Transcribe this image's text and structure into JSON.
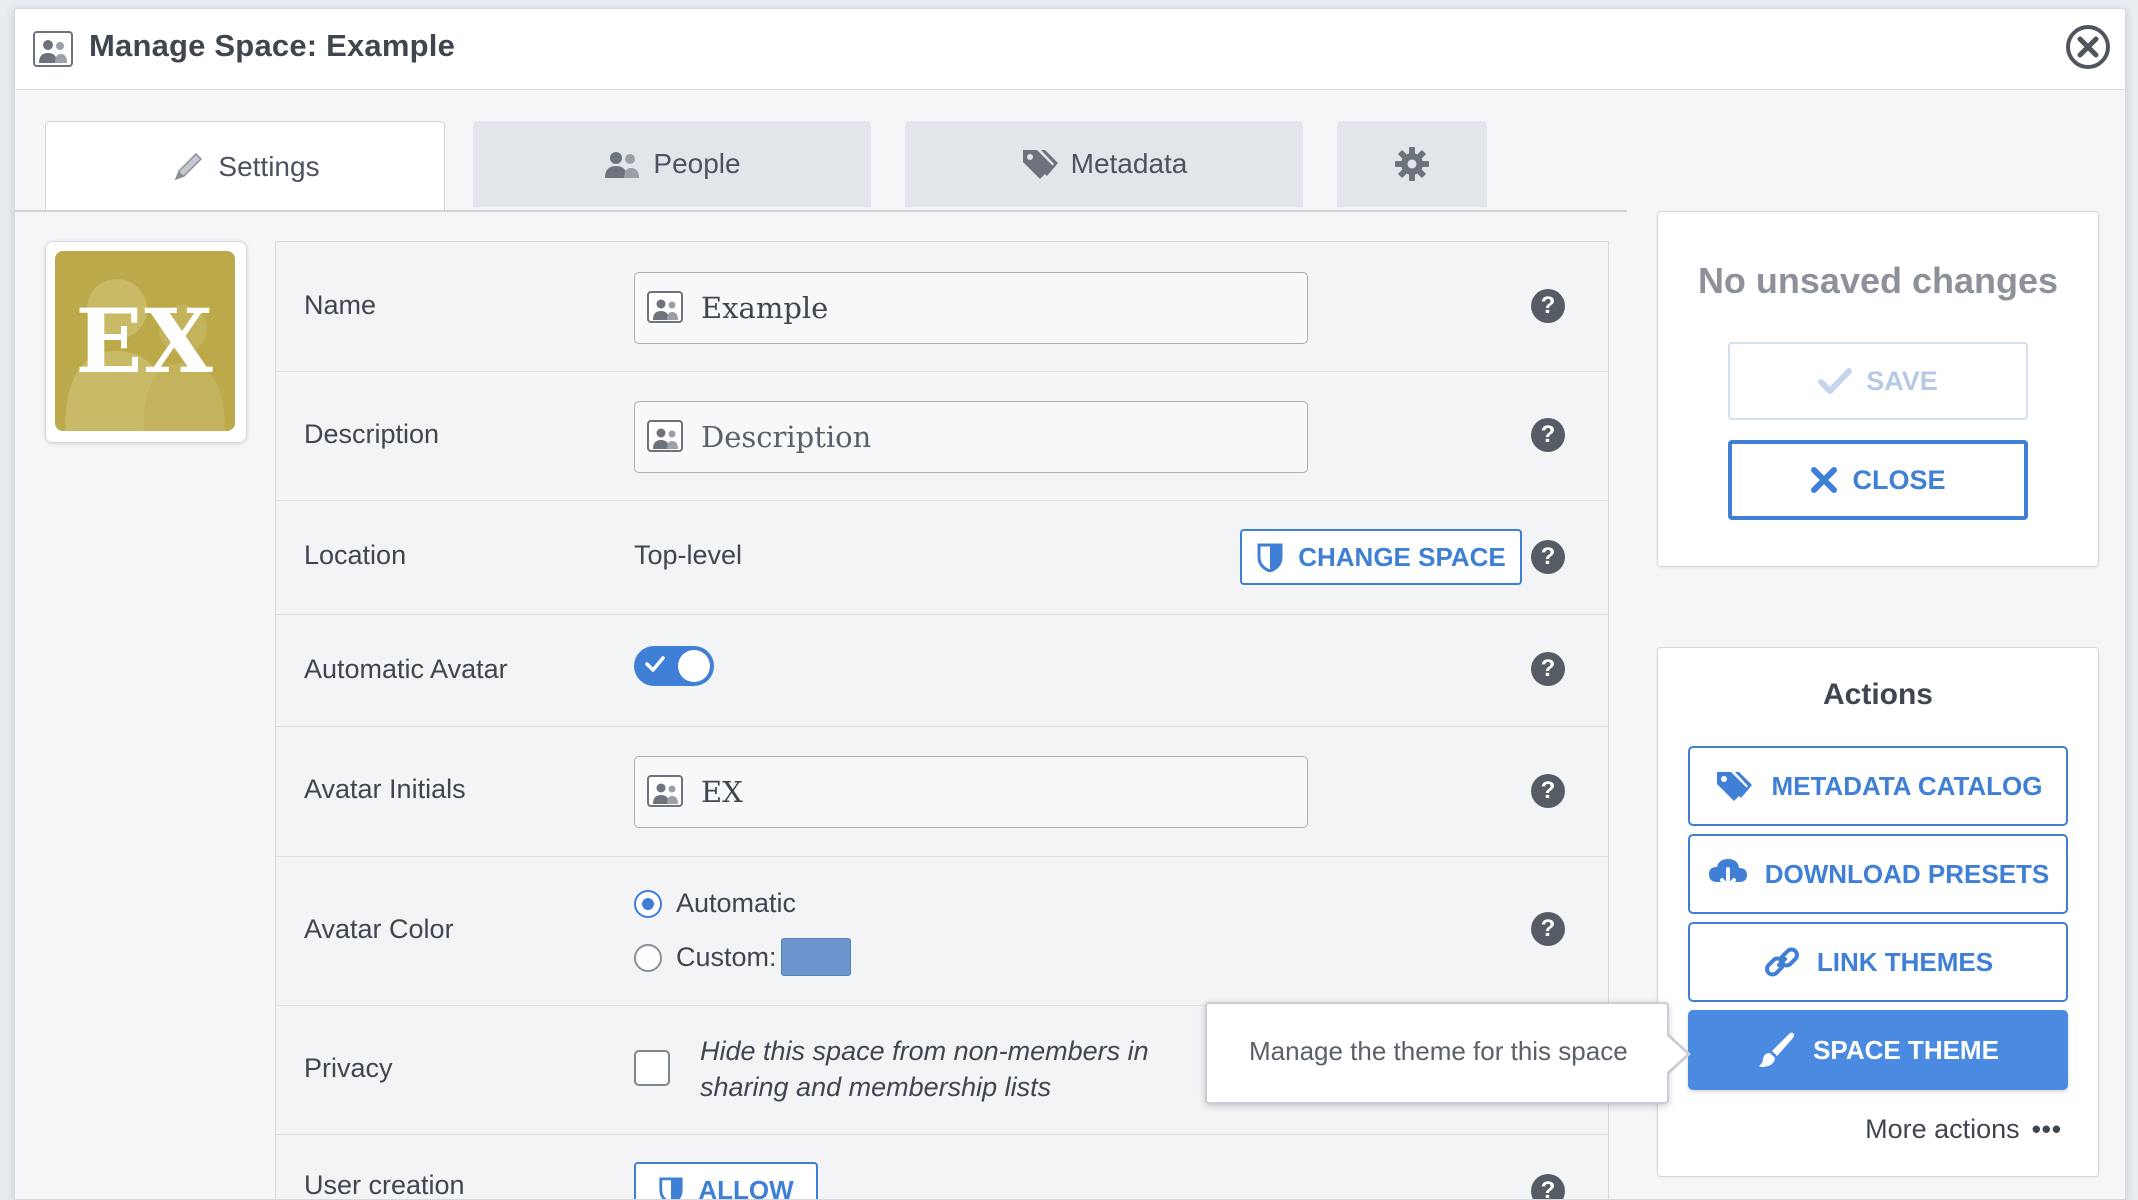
{
  "window": {
    "title": "Manage Space: Example"
  },
  "tabs": [
    {
      "label": "Settings",
      "icon": "pencil-icon",
      "active": true
    },
    {
      "label": "People",
      "icon": "people-icon",
      "active": false
    },
    {
      "label": "Metadata",
      "icon": "tags-icon",
      "active": false
    },
    {
      "label": "",
      "icon": "gear-icon",
      "active": false
    }
  ],
  "avatar": {
    "initials": "EX",
    "color": "#bba94a"
  },
  "form": {
    "name": {
      "label": "Name",
      "value": "Example"
    },
    "description": {
      "label": "Description",
      "placeholder": "Description"
    },
    "location": {
      "label": "Location",
      "value": "Top-level",
      "button": "CHANGE SPACE"
    },
    "automatic_avatar": {
      "label": "Automatic Avatar",
      "enabled": true
    },
    "avatar_initials": {
      "label": "Avatar Initials",
      "value": "EX"
    },
    "avatar_color": {
      "label": "Avatar Color",
      "options": [
        "Automatic",
        "Custom:"
      ],
      "selected": "Automatic",
      "custom_color": "#6b95cc"
    },
    "privacy": {
      "label": "Privacy",
      "text_line1": "Hide this space from non-members in",
      "text_line2": "sharing and membership lists",
      "checked": false
    },
    "user_creation": {
      "label": "User creation",
      "button": "ALLOW"
    }
  },
  "status": {
    "message": "No unsaved changes",
    "save_label": "SAVE",
    "close_label": "CLOSE"
  },
  "actions": {
    "title": "Actions",
    "buttons": [
      "METADATA CATALOG",
      "DOWNLOAD PRESETS",
      "LINK THEMES",
      "SPACE THEME"
    ],
    "more": "More actions"
  },
  "tooltip": {
    "text": "Manage the theme for this space"
  },
  "colors": {
    "accent": "#3f7fd6",
    "accent_fill": "#4a8ae0",
    "avatar_bg": "#bba94a"
  }
}
